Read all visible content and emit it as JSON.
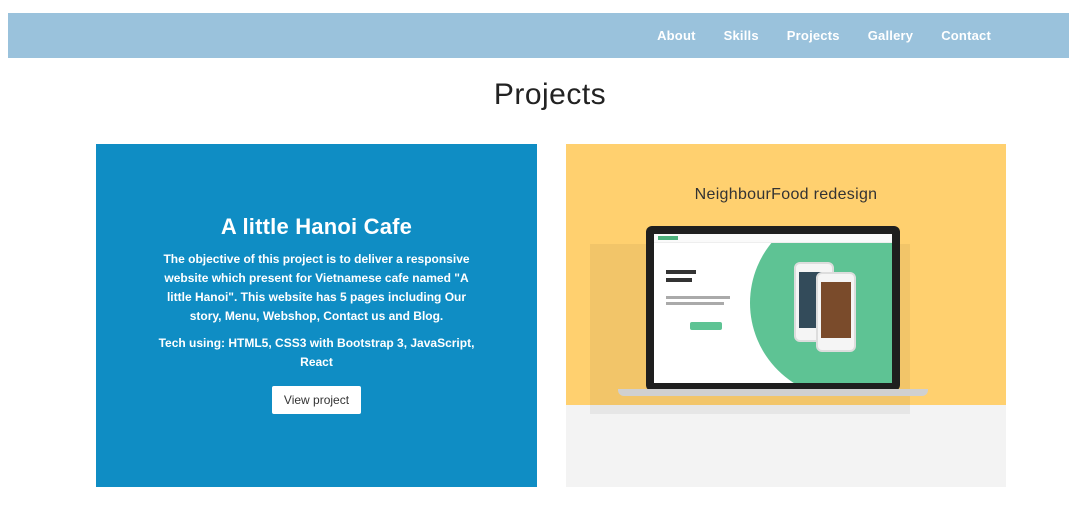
{
  "nav": {
    "links": [
      "About",
      "Skills",
      "Projects",
      "Gallery",
      "Contact"
    ]
  },
  "section": {
    "title": "Projects"
  },
  "projects": [
    {
      "title": "A little Hanoi Cafe",
      "description": "The objective of this project is to deliver a responsive website which present for Vietnamese cafe named \"A little Hanoi\". This website has 5 pages including Our story, Menu, Webshop, Contact us and Blog.",
      "tech": "Tech using: HTML5, CSS3 with Bootstrap 3, JavaScript, React",
      "button_label": "View project"
    },
    {
      "title": "NeighbourFood redesign"
    }
  ],
  "colors": {
    "nav_bg": "#9ac2dc",
    "card_blue": "#0f8dc4",
    "card_yellow": "#ffd06f",
    "accent_green": "#5ec394"
  },
  "icons": {
    "project_preview": "laptop-mockup-icon"
  }
}
